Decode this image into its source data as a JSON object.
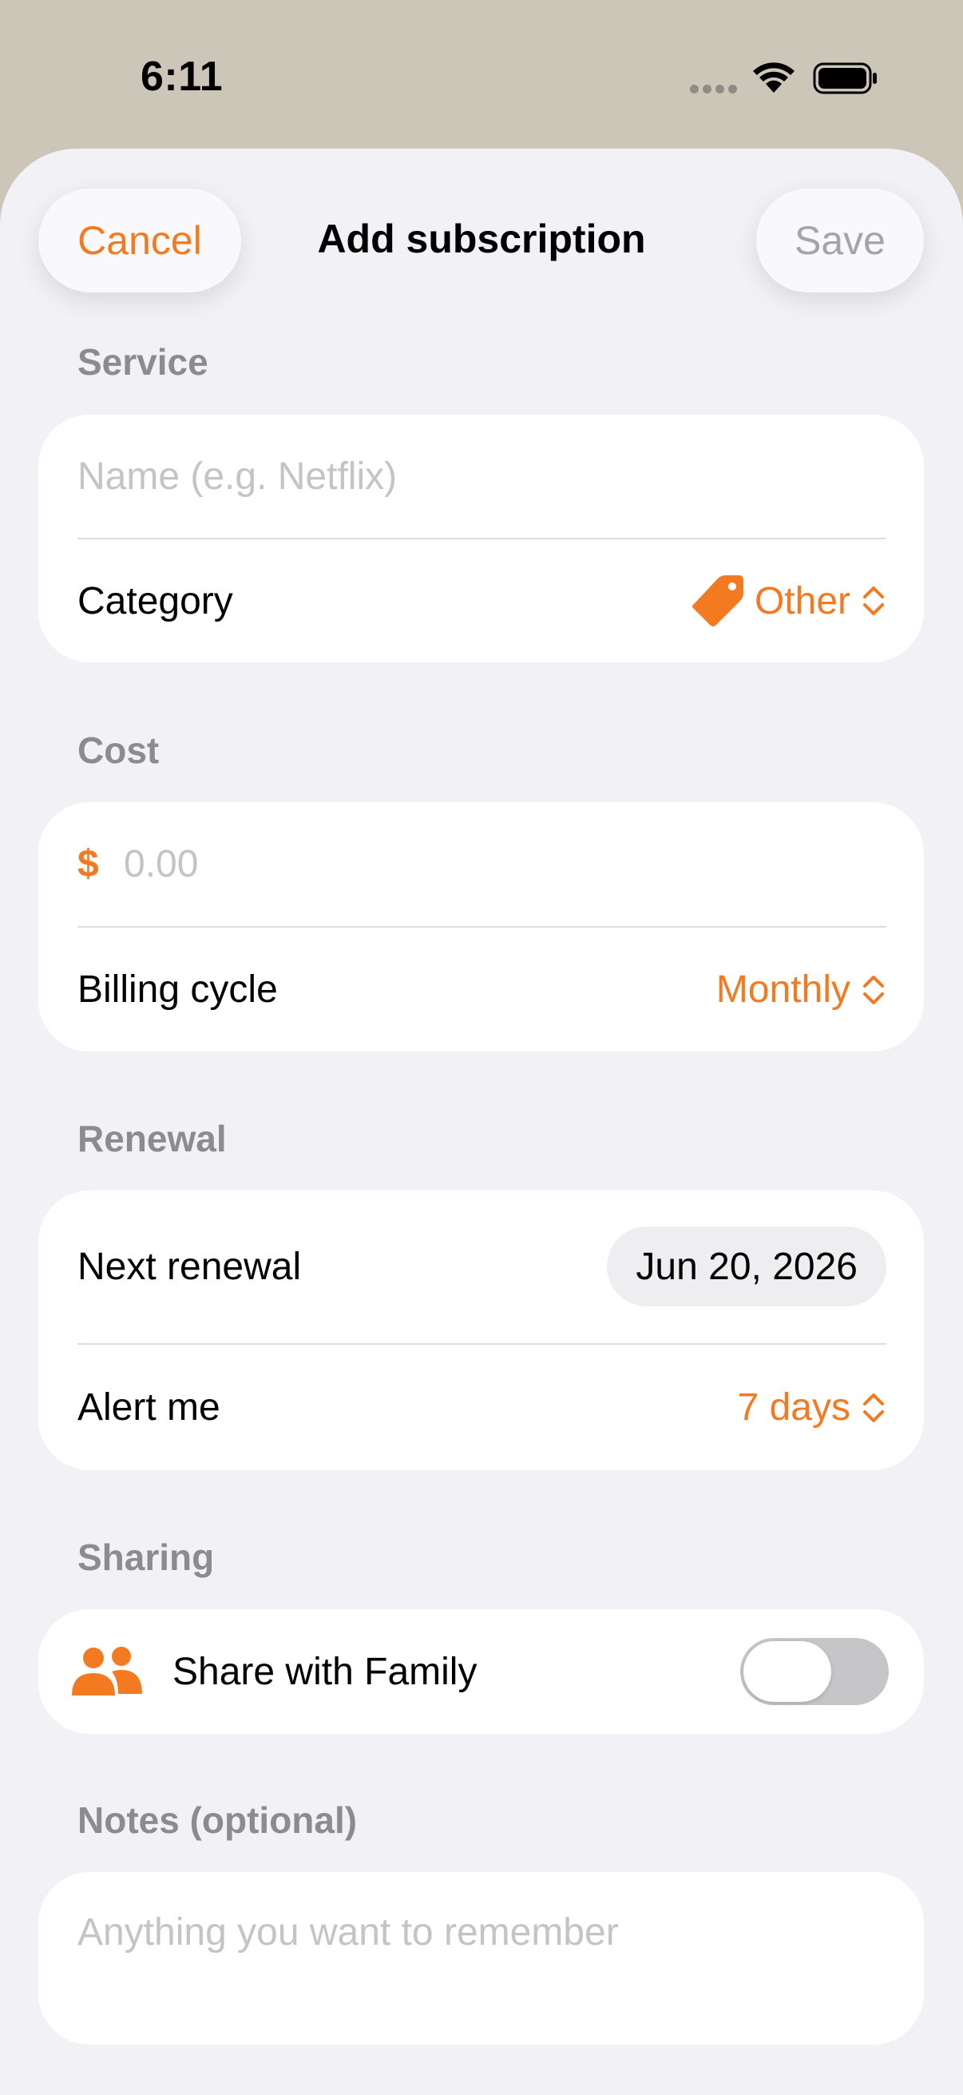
{
  "status_bar": {
    "time": "6:11"
  },
  "header": {
    "cancel_label": "Cancel",
    "title": "Add subscription",
    "save_label": "Save"
  },
  "service": {
    "section_label": "Service",
    "name_placeholder": "Name (e.g. Netflix)",
    "category_label": "Category",
    "category_value": "Other",
    "category_icon": "tag-icon"
  },
  "cost": {
    "section_label": "Cost",
    "currency_symbol": "$",
    "amount_placeholder": "0.00",
    "billing_label": "Billing cycle",
    "billing_value": "Monthly"
  },
  "renewal": {
    "section_label": "Renewal",
    "next_label": "Next renewal",
    "next_value": "Jun 20, 2026",
    "alert_label": "Alert me",
    "alert_value": "7 days"
  },
  "sharing": {
    "section_label": "Sharing",
    "share_label": "Share with Family",
    "share_icon": "family-icon",
    "share_enabled": false
  },
  "notes": {
    "section_label": "Notes (optional)",
    "placeholder": "Anything you want to remember"
  },
  "colors": {
    "accent": "#f37a20",
    "background": "#f1f1f6",
    "card": "#ffffff"
  }
}
